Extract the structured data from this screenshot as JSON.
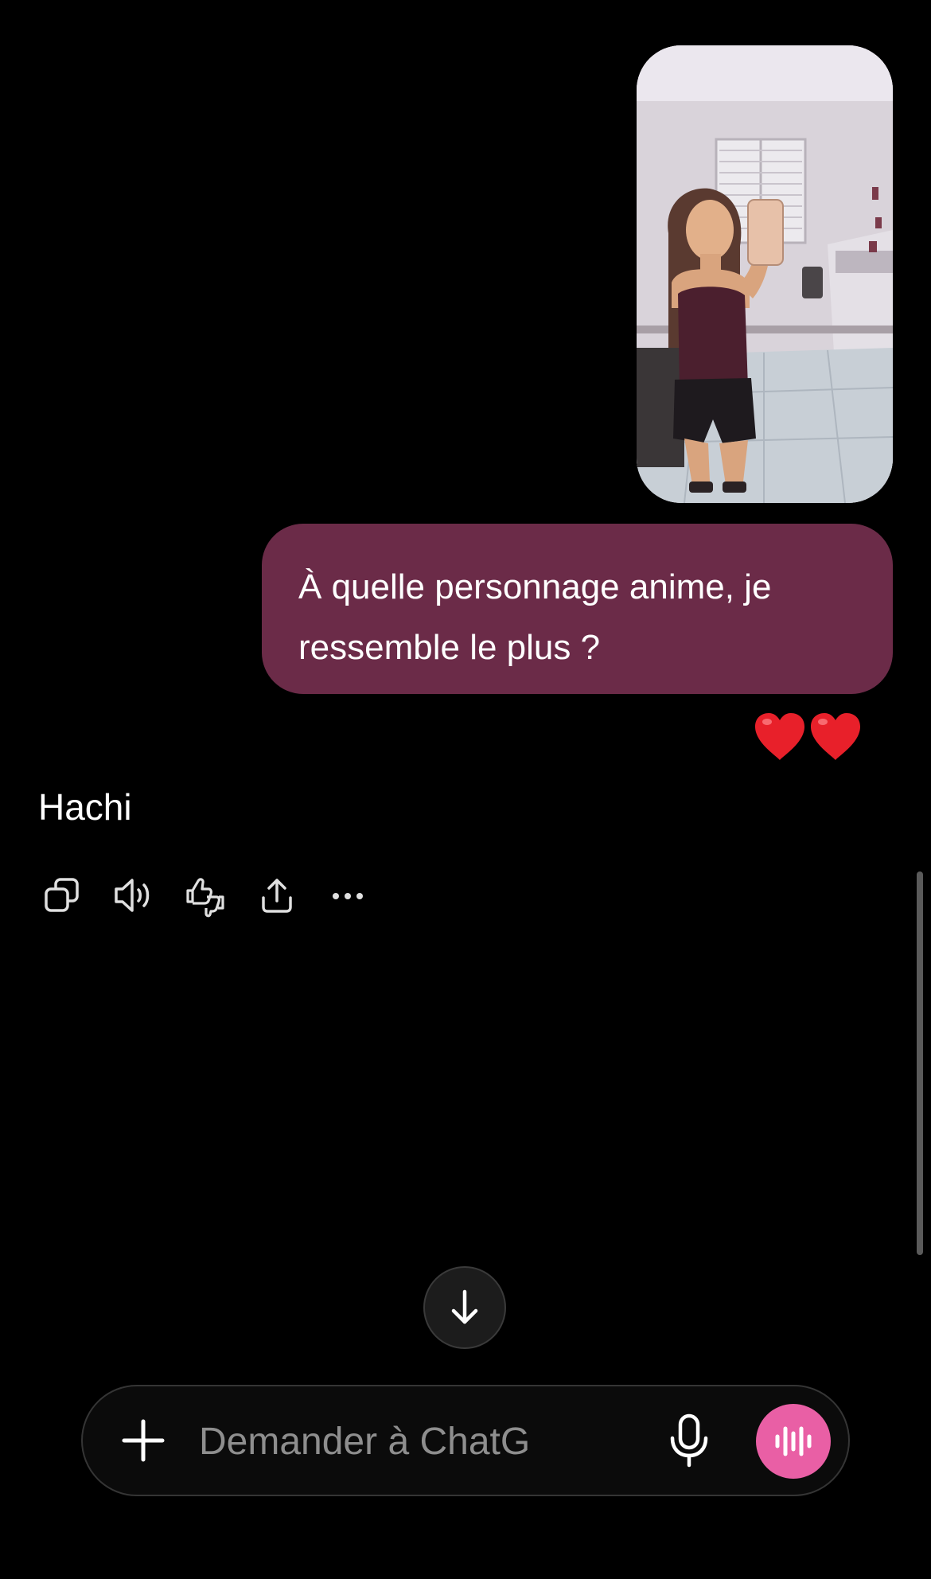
{
  "colors": {
    "background": "#000000",
    "user_bubble": "#6b2b48",
    "voice_button": "#e95fa5",
    "heart": "#e8202a",
    "placeholder": "#8e8e8e"
  },
  "conversation": {
    "attachment": {
      "icon": "photo-attachment"
    },
    "user_message": {
      "line1": "À quelle personnage anime, je",
      "line2": "ressemble le plus ?"
    },
    "reactions": [
      "heart",
      "heart"
    ],
    "assistant_reply": "Hachi",
    "reply_actions": [
      {
        "icon": "copy-icon"
      },
      {
        "icon": "read-aloud-icon"
      },
      {
        "icon": "feedback-thumbs-icon"
      },
      {
        "icon": "share-icon"
      },
      {
        "icon": "more-icon"
      }
    ]
  },
  "scroll_down": {
    "icon": "arrow-down-icon"
  },
  "composer": {
    "placeholder": "Demander à ChatGPT",
    "value": "",
    "add_icon": "plus-icon",
    "mic_icon": "microphone-icon",
    "voice_icon": "voice-mode-icon"
  }
}
